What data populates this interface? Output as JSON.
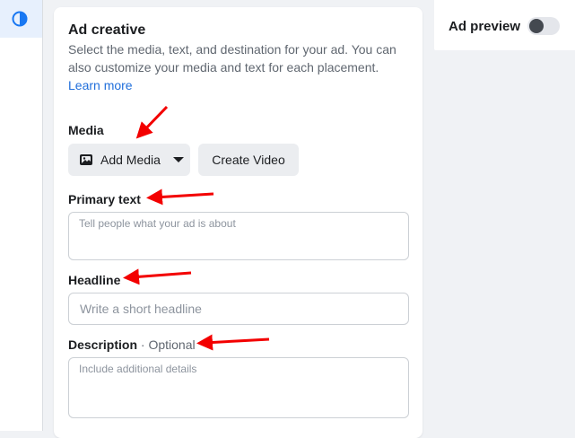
{
  "sidebar": {
    "items": [
      {
        "icon": "contrast-icon",
        "active": true
      }
    ]
  },
  "ad_creative": {
    "title": "Ad creative",
    "description": "Select the media, text, and destination for your ad. You can also customize your media and text for each placement.",
    "learn_more": "Learn more",
    "media": {
      "label": "Media",
      "add_media_label": "Add Media",
      "create_video_label": "Create Video"
    },
    "primary_text": {
      "label": "Primary text",
      "placeholder": "Tell people what your ad is about"
    },
    "headline": {
      "label": "Headline",
      "placeholder": "Write a short headline"
    },
    "description_field": {
      "label": "Description",
      "optional_label": "· Optional",
      "placeholder": "Include additional details"
    }
  },
  "ad_preview": {
    "title": "Ad preview",
    "toggle_on": false
  },
  "colors": {
    "accent": "#216fdb",
    "annotation_arrow": "#f30000"
  }
}
